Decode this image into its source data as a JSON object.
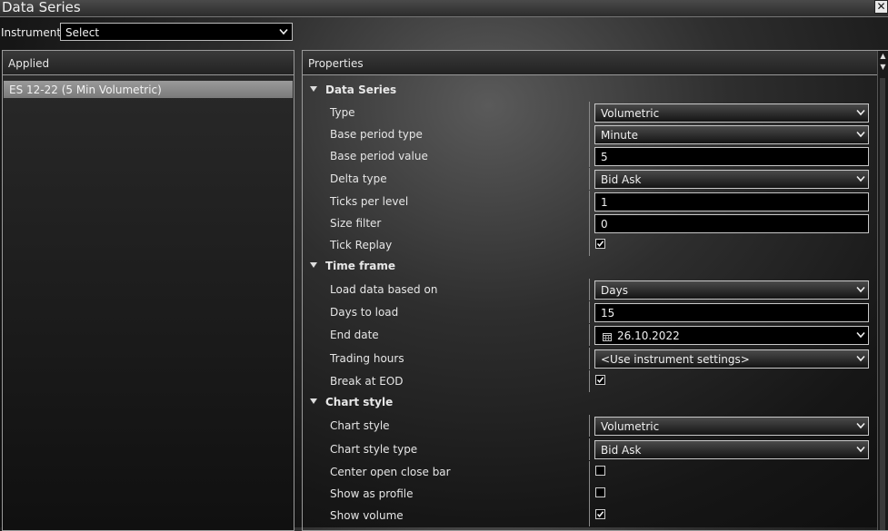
{
  "window": {
    "title": "Data Series",
    "close_icon": "close-icon"
  },
  "instrument": {
    "label": "Instrument",
    "value": "Select"
  },
  "applied": {
    "header": "Applied",
    "items": [
      {
        "label": "ES 12-22 (5 Min Volumetric)",
        "selected": true
      }
    ]
  },
  "properties": {
    "header": "Properties",
    "data_series": {
      "title": "Data Series",
      "type": {
        "label": "Type",
        "value": "Volumetric"
      },
      "base_period_type": {
        "label": "Base period type",
        "value": "Minute"
      },
      "base_period_value": {
        "label": "Base period value",
        "value": "5"
      },
      "delta_type": {
        "label": "Delta type",
        "value": "Bid Ask"
      },
      "ticks_per_level": {
        "label": "Ticks per level",
        "value": "1"
      },
      "size_filter": {
        "label": "Size filter",
        "value": "0"
      },
      "tick_replay": {
        "label": "Tick Replay",
        "checked": true
      }
    },
    "time_frame": {
      "title": "Time frame",
      "load_data_based_on": {
        "label": "Load data based on",
        "value": "Days"
      },
      "days_to_load": {
        "label": "Days to load",
        "value": "15"
      },
      "end_date": {
        "label": "End date",
        "value": "26.10.2022"
      },
      "trading_hours": {
        "label": "Trading hours",
        "value": "<Use instrument settings>"
      },
      "break_at_eod": {
        "label": "Break at EOD",
        "checked": true
      }
    },
    "chart_style": {
      "title": "Chart style",
      "chart_style": {
        "label": "Chart style",
        "value": "Volumetric"
      },
      "chart_style_type": {
        "label": "Chart style type",
        "value": "Bid Ask"
      },
      "center_open_close_bar": {
        "label": "Center open close bar",
        "checked": false
      },
      "show_as_profile": {
        "label": "Show as profile",
        "checked": false
      },
      "show_volume": {
        "label": "Show volume",
        "checked": true
      }
    }
  }
}
